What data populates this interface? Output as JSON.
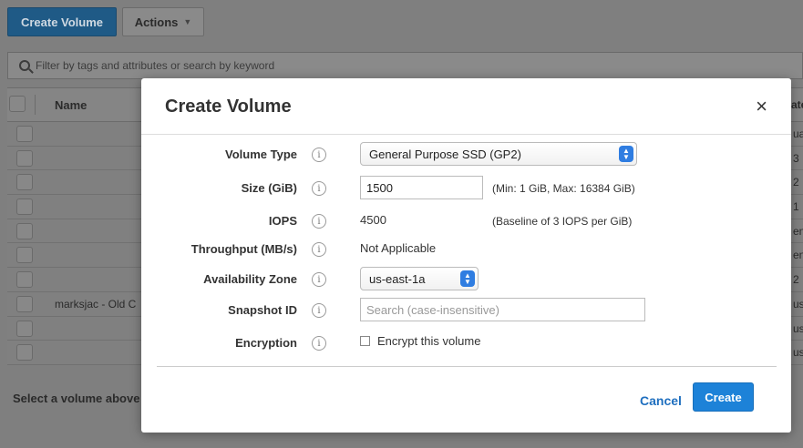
{
  "toolbar": {
    "create_volume_label": "Create Volume",
    "actions_label": "Actions"
  },
  "search": {
    "placeholder": "Filter by tags and attributes or search by keyword"
  },
  "table": {
    "column_name": "Name",
    "right_header": "ate",
    "rows": [
      {
        "name": "",
        "right": "ua"
      },
      {
        "name": "",
        "right": "3"
      },
      {
        "name": "",
        "right": "2"
      },
      {
        "name": "",
        "right": "1"
      },
      {
        "name": "",
        "right": "en"
      },
      {
        "name": "",
        "right": "en"
      },
      {
        "name": "",
        "right": "2"
      },
      {
        "name": "marksjac - Old C",
        "right": "us"
      },
      {
        "name": "",
        "right": "us"
      },
      {
        "name": "",
        "right": "us"
      }
    ],
    "footer": "Select a volume above"
  },
  "modal": {
    "title": "Create Volume",
    "close_glyph": "×",
    "info_glyph": "i",
    "volume_type": {
      "label": "Volume Type",
      "value": "General Purpose SSD (GP2)"
    },
    "size": {
      "label": "Size (GiB)",
      "value": "1500",
      "hint": "(Min: 1 GiB, Max: 16384 GiB)"
    },
    "iops": {
      "label": "IOPS",
      "value": "4500",
      "hint": "(Baseline of 3 IOPS per GiB)"
    },
    "throughput": {
      "label": "Throughput (MB/s)",
      "value": "Not Applicable"
    },
    "availability_zone": {
      "label": "Availability Zone",
      "value": "us-east-1a"
    },
    "snapshot": {
      "label": "Snapshot ID",
      "placeholder": "Search (case-insensitive)"
    },
    "encryption": {
      "label": "Encryption",
      "checkbox_label": "Encrypt this volume",
      "checked": false
    },
    "cancel_label": "Cancel",
    "create_label": "Create"
  },
  "colors": {
    "primary_button": "#1d82d8",
    "link": "#1f6fbf",
    "select_arrow": "#2f7de1"
  }
}
